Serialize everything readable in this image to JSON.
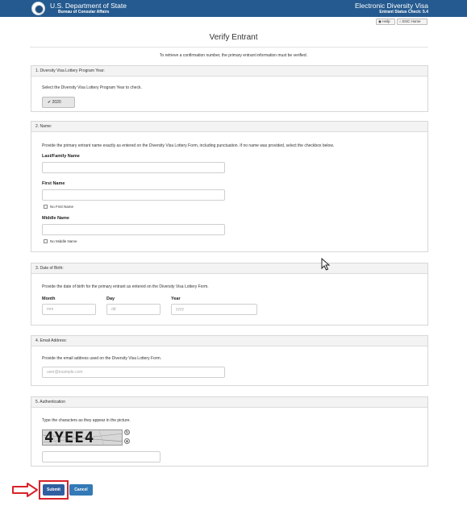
{
  "header": {
    "department": "U.S. Department of State",
    "bureau": "Bureau of Consular Affairs",
    "program": "Electronic Diversity Visa",
    "status_check": "Entrant Status Check: 5.4",
    "help_label": "Help",
    "home_label": "ESC Home"
  },
  "page": {
    "title": "Verify Entrant",
    "intro": "To retrieve a confirmation number, the primary entrant information must be verified."
  },
  "sections": {
    "program_year": {
      "title": "1. Diversity Visa Lottery Program Year:",
      "help": "Select the Diversity Visa Lottery Program Year to check.",
      "selected_year": "2020"
    },
    "name": {
      "title": "2. Name:",
      "help": "Provide the primary entrant name exactly as entered on the Diversity Visa Lottery Form, including punctuation. If no name was provided, select the checkbox below.",
      "last_label": "Last/Family Name",
      "first_label": "First Name",
      "no_first_label": "No First Name",
      "middle_label": "Middle Name",
      "no_middle_label": "No Middle Name",
      "last_value": "",
      "first_value": "",
      "middle_value": ""
    },
    "dob": {
      "title": "3. Date of Birth:",
      "help": "Provide the date of birth for the primary entrant as entered on the Diversity Visa Lottery Form.",
      "month_label": "Month",
      "day_label": "Day",
      "year_label": "Year",
      "month_placeholder": "mm",
      "day_placeholder": "dd",
      "year_placeholder": "yyyy"
    },
    "email": {
      "title": "4. Email Address:",
      "help": "Provide the email address used on the Diversity Visa Lottery Form.",
      "placeholder": "user@example.com"
    },
    "auth": {
      "title": "5. Authentication",
      "help": "Type the characters as they appear in the picture.",
      "captcha_text": "4YEE4",
      "refresh_icon": "refresh-icon",
      "audio_icon": "audio-icon"
    }
  },
  "actions": {
    "submit_label": "Submit",
    "cancel_label": "Cancel"
  },
  "colors": {
    "header_bg": "#245a8f",
    "submit_bg": "#2f5fa0",
    "cancel_bg": "#337ab7",
    "highlight": "#d8232a"
  }
}
